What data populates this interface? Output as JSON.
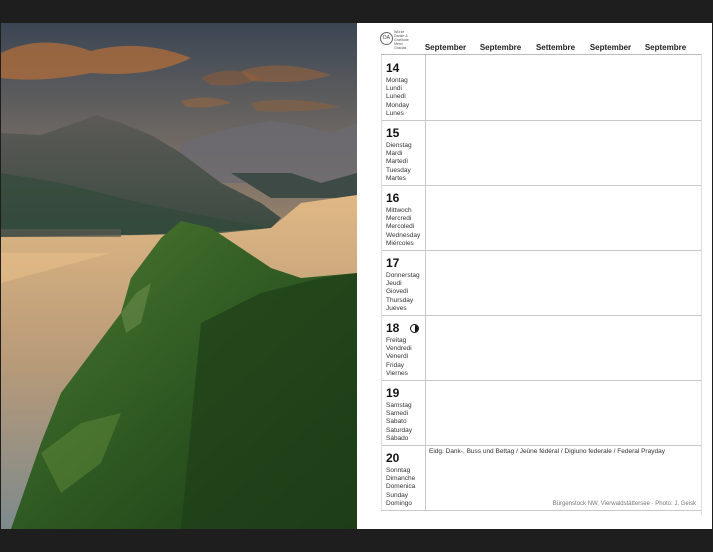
{
  "logo": {
    "mark": "DA",
    "lines": [
      "Würze",
      "Danke &",
      "Gratitude",
      "Merci",
      "Gracias"
    ]
  },
  "months": [
    "September",
    "Septembre",
    "Settembre",
    "September",
    "Septembre"
  ],
  "days": [
    {
      "num": "14",
      "names": [
        "Montag",
        "Lundi",
        "Lunedì",
        "Monday",
        "Lunes"
      ]
    },
    {
      "num": "15",
      "names": [
        "Dienstag",
        "Mardi",
        "Martedì",
        "Tuesday",
        "Martes"
      ]
    },
    {
      "num": "16",
      "names": [
        "Mittwoch",
        "Mercredi",
        "Mercoledì",
        "Wednesday",
        "Miércoles"
      ]
    },
    {
      "num": "17",
      "names": [
        "Donnerstag",
        "Jeudi",
        "Giovedì",
        "Thursday",
        "Jueves"
      ]
    },
    {
      "num": "18",
      "names": [
        "Freitag",
        "Vendredi",
        "Venerdì",
        "Friday",
        "Viernes"
      ],
      "moon": "moon-phase-icon"
    },
    {
      "num": "19",
      "names": [
        "Samstag",
        "Samedi",
        "Sabato",
        "Saturday",
        "Sábado"
      ]
    },
    {
      "num": "20",
      "names": [
        "Sonntag",
        "Dimanche",
        "Domenica",
        "Sunday",
        "Domingo"
      ],
      "holiday": "Eidg. Dank-, Buss und Bettag / Jeûne fédéral / Digiuno federale / Federal Prayday"
    }
  ],
  "photo_credit": "Bürgenstock NW, Vierwaldstättersee · Photo: J. Geisk",
  "photo": {
    "icon": "landscape-photo",
    "sky_top": "#3a4452",
    "sky_glow": "#f3b064",
    "lake": "#c9a77a",
    "forest": "#2f5a22"
  }
}
